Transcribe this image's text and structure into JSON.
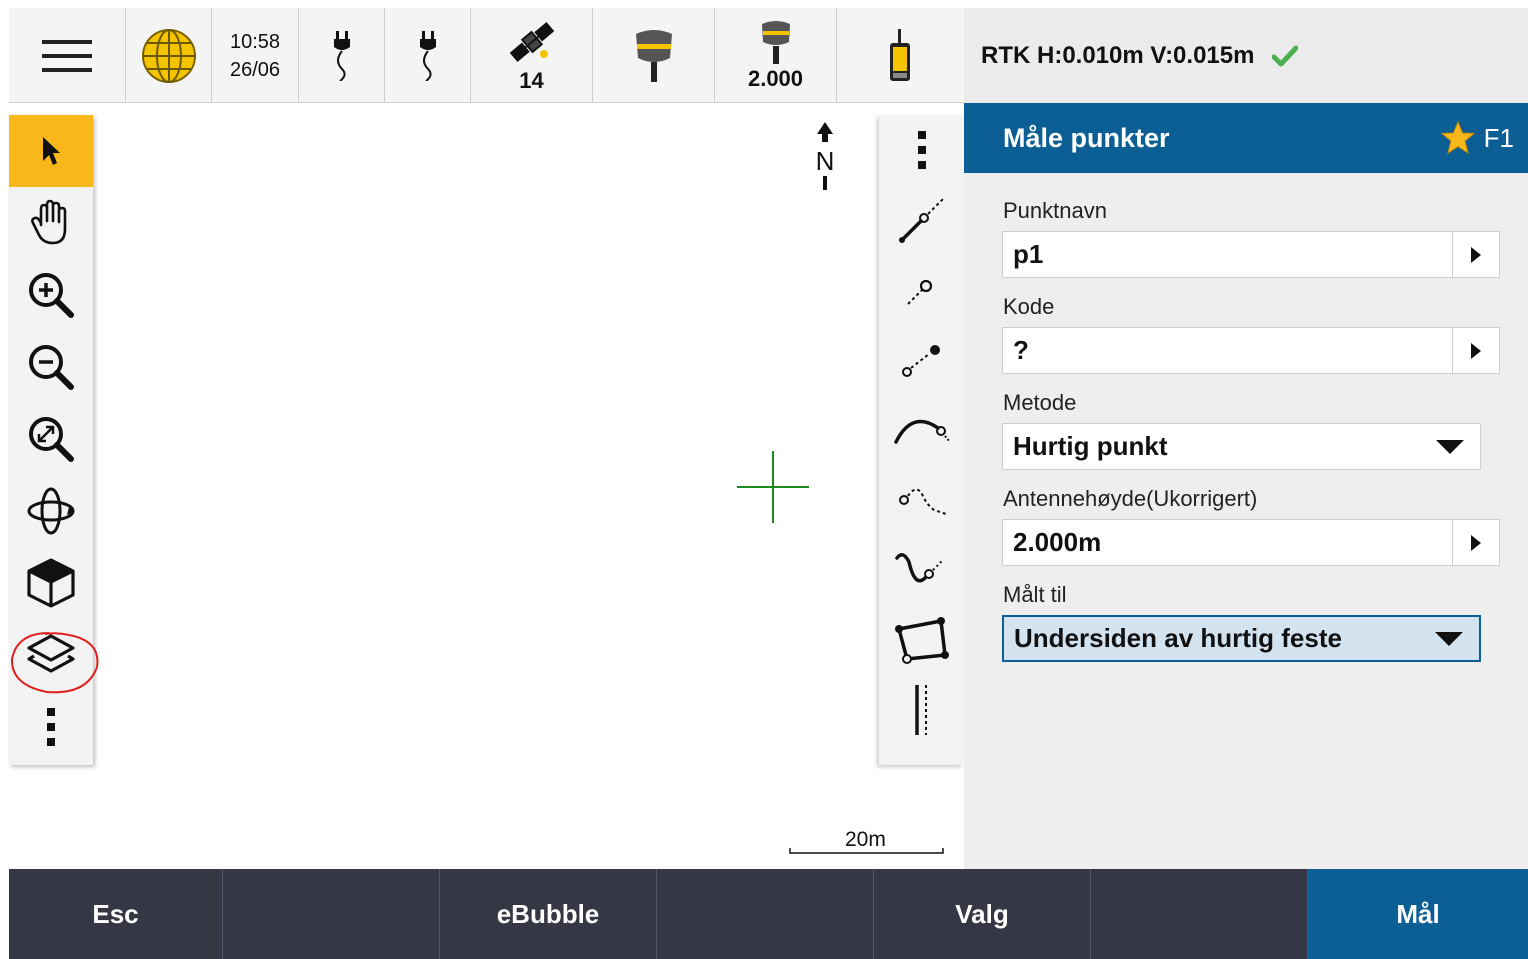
{
  "status_bar": {
    "time": "10:58",
    "date": "26/06",
    "satellites": "14",
    "antenna_height": "2.000"
  },
  "rtk": {
    "text": "RTK H:0.010m V:0.015m",
    "check_color": "#4caf50"
  },
  "map": {
    "north_label": "N",
    "scale_label": "20m"
  },
  "left_toolbar": {
    "tools": [
      "select-arrow-icon",
      "pan-hand-icon",
      "zoom-in-icon",
      "zoom-out-icon",
      "zoom-extents-icon",
      "orbit-icon",
      "3d-cube-icon",
      "layers-icon",
      "more-icon"
    ],
    "active": "select-arrow-icon",
    "accent": "#f8b81c"
  },
  "right_toolbar": {
    "tools": [
      "more-icon",
      "measure-line-icon",
      "measure-point-icon",
      "offset-point-icon",
      "arc-icon",
      "polyline-icon",
      "curve-icon",
      "polygon-icon",
      "station-icon"
    ]
  },
  "panel": {
    "title": "Måle punkter",
    "fkey": "F1",
    "header_color": "#0b5f95",
    "fields": {
      "point_name": {
        "label": "Punktnavn",
        "value": "p1"
      },
      "code": {
        "label": "Kode",
        "value": "?"
      },
      "method": {
        "label": "Metode",
        "value": "Hurtig punkt"
      },
      "antenna_height": {
        "label": "Antennehøyde(Ukorrigert)",
        "value": "2.000m"
      },
      "measured_to": {
        "label": "Målt til",
        "value": "Undersiden av hurtig feste"
      }
    }
  },
  "softkeys": {
    "esc": "Esc",
    "slot2": "",
    "ebubble": "eBubble",
    "slot4": "",
    "options": "Valg",
    "slot6": "",
    "measure": "Mål"
  }
}
